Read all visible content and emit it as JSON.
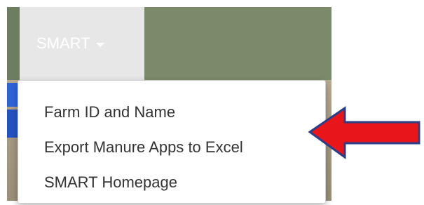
{
  "navbar": {
    "menu_label": "SMART",
    "colors": {
      "navbar_bg": "#7a8a6a",
      "tab_bg": "#e7e7e7",
      "tab_text": "#ffffff"
    }
  },
  "dropdown": {
    "items": [
      {
        "label": "Farm ID and Name"
      },
      {
        "label": "Export Manure Apps to Excel"
      },
      {
        "label": "SMART Homepage"
      }
    ]
  },
  "annotation": {
    "icon": "red-arrow-left",
    "color": "#e8151b",
    "outline": "#2c3e87"
  }
}
